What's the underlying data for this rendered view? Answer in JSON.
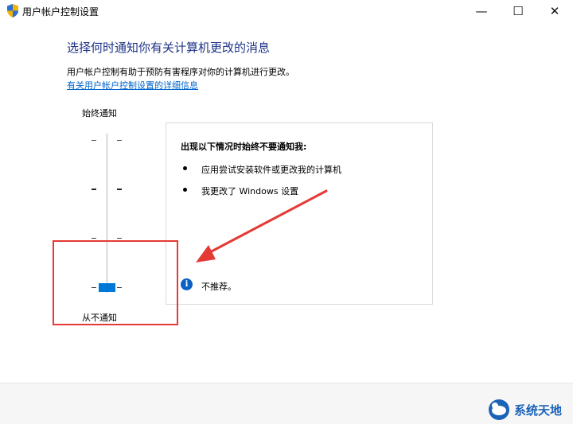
{
  "window": {
    "title": "用户帐户控制设置",
    "minimize_glyph": "—",
    "maximize_glyph": "☐",
    "close_glyph": "✕"
  },
  "main": {
    "heading": "选择何时通知你有关计算机更改的消息",
    "description": "用户帐户控制有助于预防有害程序对你的计算机进行更改。",
    "link_text": "有关用户帐户控制设置的详细信息"
  },
  "slider": {
    "top_label": "始终通知",
    "bottom_label": "从不通知",
    "levels": 4,
    "selected_level": 1,
    "accent_color": "#0078d7"
  },
  "info_box": {
    "title": "出现以下情况时始终不要通知我:",
    "items": [
      "应用尝试安装软件或更改我的计算机",
      "我更改了 Windows 设置"
    ],
    "note": "不推荐。"
  },
  "annotation": {
    "highlight_color": "#e53935"
  },
  "watermark": {
    "text": "系统天地"
  }
}
